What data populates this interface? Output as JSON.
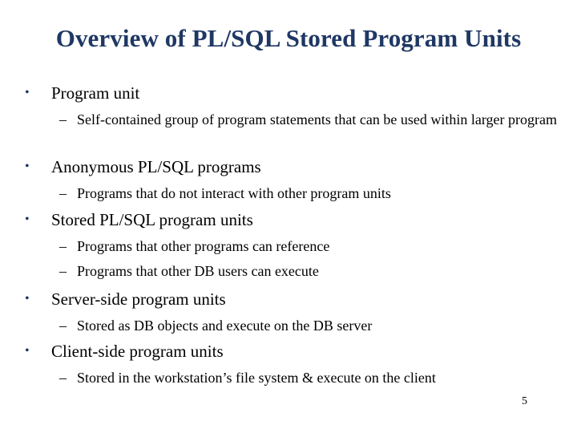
{
  "slide": {
    "title": "Overview of PL/SQL Stored Program Units",
    "bullet_glyph": "•",
    "dash_glyph": "–",
    "items": [
      {
        "label": "Program unit",
        "sub": [
          "Self-contained group of program statements that can be used within larger program"
        ]
      },
      {
        "label": "Anonymous PL/SQL programs",
        "sub": [
          "Programs that do not interact with other program units"
        ]
      },
      {
        "label": "Stored PL/SQL program units",
        "sub": [
          "Programs that other programs can reference",
          "Programs that other DB users can execute"
        ]
      },
      {
        "label": "Server-side program units",
        "sub": [
          "Stored as DB objects and execute on the DB server"
        ]
      },
      {
        "label": "Client-side program units",
        "sub": [
          "Stored in the workstation’s file system & execute on the client"
        ]
      }
    ],
    "page_number": "5",
    "colors": {
      "title": "#1f3864",
      "bullet": "#1f3864",
      "text": "#000000"
    }
  }
}
